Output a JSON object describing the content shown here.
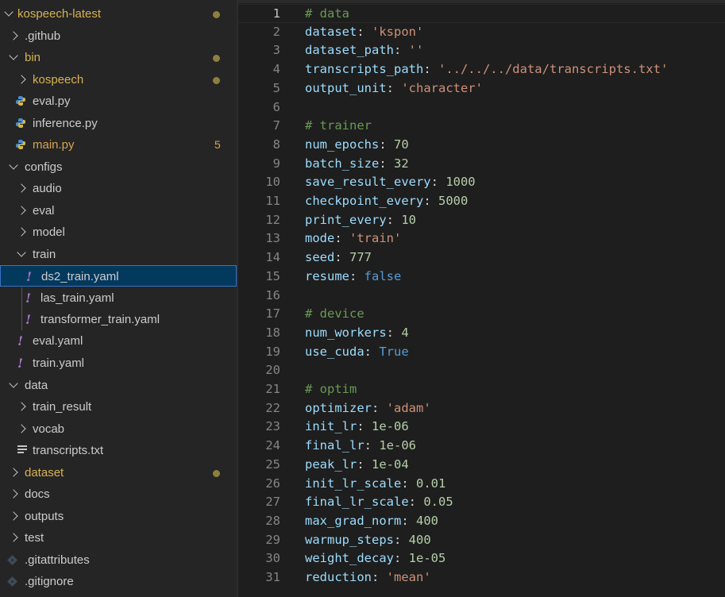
{
  "explorer": {
    "root": "kospeech-latest",
    "items": [
      {
        "label": ".github"
      },
      {
        "label": "bin"
      },
      {
        "label": "kospeech"
      },
      {
        "label": "eval.py"
      },
      {
        "label": "inference.py"
      },
      {
        "label": "main.py",
        "badge": "5"
      },
      {
        "label": "configs"
      },
      {
        "label": "audio"
      },
      {
        "label": "eval"
      },
      {
        "label": "model"
      },
      {
        "label": "train"
      },
      {
        "label": "ds2_train.yaml"
      },
      {
        "label": "las_train.yaml"
      },
      {
        "label": "transformer_train.yaml"
      },
      {
        "label": "eval.yaml"
      },
      {
        "label": "train.yaml"
      },
      {
        "label": "data"
      },
      {
        "label": "train_result"
      },
      {
        "label": "vocab"
      },
      {
        "label": "transcripts.txt"
      },
      {
        "label": "dataset"
      },
      {
        "label": "docs"
      },
      {
        "label": "outputs"
      },
      {
        "label": "test"
      },
      {
        "label": ".gitattributes"
      },
      {
        "label": ".gitignore"
      }
    ]
  },
  "editor": {
    "lines": [
      {
        "n": "1",
        "k": "# data"
      },
      {
        "n": "2",
        "k": "dataset",
        "v": "'kspon'"
      },
      {
        "n": "3",
        "k": "dataset_path",
        "v": "''"
      },
      {
        "n": "4",
        "k": "transcripts_path",
        "v": "'../../../data/transcripts.txt'"
      },
      {
        "n": "5",
        "k": "output_unit",
        "v": "'character'"
      },
      {
        "n": "6"
      },
      {
        "n": "7",
        "k": "# trainer"
      },
      {
        "n": "8",
        "k": "num_epochs",
        "v": "70"
      },
      {
        "n": "9",
        "k": "batch_size",
        "v": "32"
      },
      {
        "n": "10",
        "k": "save_result_every",
        "v": "1000"
      },
      {
        "n": "11",
        "k": "checkpoint_every",
        "v": "5000"
      },
      {
        "n": "12",
        "k": "print_every",
        "v": "10"
      },
      {
        "n": "13",
        "k": "mode",
        "v": "'train'"
      },
      {
        "n": "14",
        "k": "seed",
        "v": "777"
      },
      {
        "n": "15",
        "k": "resume",
        "v": "false"
      },
      {
        "n": "16"
      },
      {
        "n": "17",
        "k": "# device"
      },
      {
        "n": "18",
        "k": "num_workers",
        "v": "4"
      },
      {
        "n": "19",
        "k": "use_cuda",
        "v": "True"
      },
      {
        "n": "20"
      },
      {
        "n": "21",
        "k": "# optim"
      },
      {
        "n": "22",
        "k": "optimizer",
        "v": "'adam'"
      },
      {
        "n": "23",
        "k": "init_lr",
        "v": "1e-06"
      },
      {
        "n": "24",
        "k": "final_lr",
        "v": "1e-06"
      },
      {
        "n": "25",
        "k": "peak_lr",
        "v": "1e-04"
      },
      {
        "n": "26",
        "k": "init_lr_scale",
        "v": "0.01"
      },
      {
        "n": "27",
        "k": "final_lr_scale",
        "v": "0.05"
      },
      {
        "n": "28",
        "k": "max_grad_norm",
        "v": "400"
      },
      {
        "n": "29",
        "k": "warmup_steps",
        "v": "400"
      },
      {
        "n": "30",
        "k": "weight_decay",
        "v": "1e-05"
      },
      {
        "n": "31",
        "k": "reduction",
        "v": "'mean'"
      }
    ],
    "separator": ": "
  }
}
